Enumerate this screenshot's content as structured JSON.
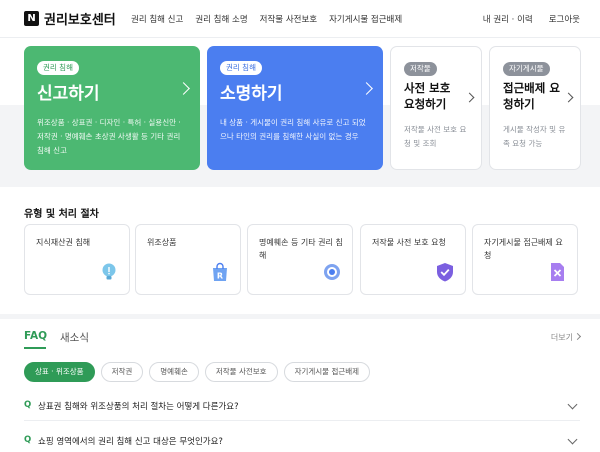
{
  "header": {
    "logo_mark": "N",
    "title": "권리보호센터",
    "nav": [
      "권리 침해 신고",
      "권리 침해 소명",
      "저작물 사전보호",
      "자기게시물 접근배제"
    ],
    "util": [
      "내 권리 · 이력",
      "로그아웃"
    ]
  },
  "cards": {
    "report": {
      "badge": "권리 침해",
      "title": "신고하기",
      "desc": "위조상품 · 상표권 · 디자인 · 특허 · 실용신안 · 저작권 · 명예훼손 초상권 사생활 등 기타 권리 침해 신고"
    },
    "explain": {
      "badge": "권리 침해",
      "title": "소명하기",
      "desc": "내 상품 · 게시물이 권리 침해 사유로 신고 되었으나 타인의 권리를 침해한 사실이 없는 경우"
    },
    "prior": {
      "badge": "저작물",
      "title": "사전 보호 요청하기",
      "desc": "저작물 사전 보호 요청 및 조회"
    },
    "access": {
      "badge": "자기게시물",
      "title": "접근배제 요청하기",
      "desc": "게시물 작성자 및 유족 요청 가능"
    }
  },
  "process": {
    "title": "유형 및 처리 절차",
    "items": [
      "지식재산권 침해",
      "위조상품",
      "명예훼손 등 기타 권리 침해",
      "저작물 사전 보호 요청",
      "자기게시물 접근배제 요청"
    ]
  },
  "faq": {
    "tabs": [
      "FAQ",
      "새소식"
    ],
    "more": "더보기",
    "chips": [
      "상표 · 위조상품",
      "저작권",
      "명예훼손",
      "저작물 사전보호",
      "자기게시물 접근배제"
    ],
    "q_mark": "Q",
    "questions": [
      "상표권 침해와 위조상품의 처리 절차는 어떻게 다른가요?",
      "쇼핑 영역에서의 권리 침해 신고 대상은 무엇인가요?"
    ]
  },
  "colors": {
    "green": "#4cb872",
    "blue": "#4b7ef0",
    "accent": "#2f9b57"
  }
}
